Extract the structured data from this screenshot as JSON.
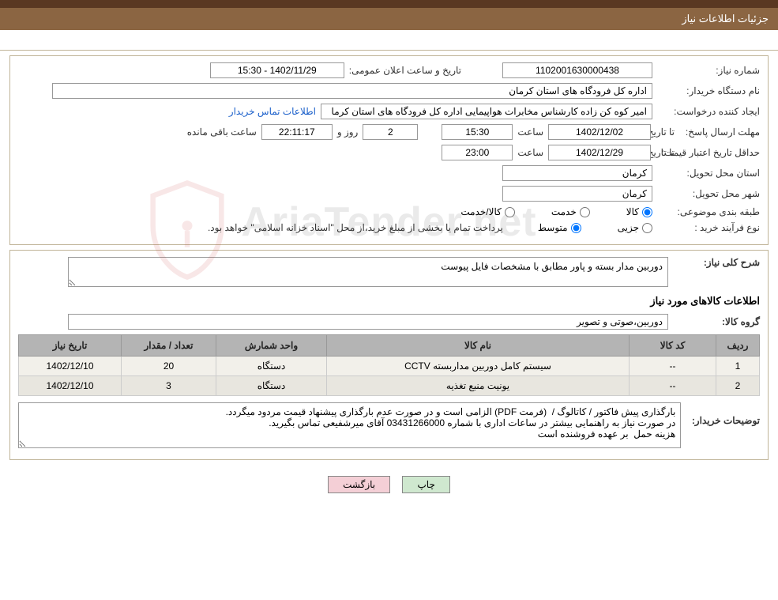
{
  "header": {
    "title": "جزئیات اطلاعات نیاز"
  },
  "fields": {
    "need_number_label": "شماره نیاز:",
    "need_number": "1102001630000438",
    "announce_label": "تاریخ و ساعت اعلان عمومی:",
    "announce_value": "1402/11/29 - 15:30",
    "buyer_org_label": "نام دستگاه خریدار:",
    "buyer_org": "اداره کل فرودگاه های استان کرمان",
    "requester_label": "ایجاد کننده درخواست:",
    "requester": "امیر کوه کن زاده کارشناس مخابرات هواپیمایی اداره کل فرودگاه های استان کرما",
    "buyer_contact_link": "اطلاعات تماس خریدار",
    "deadline_label_1": "مهلت ارسال پاسخ:",
    "deadline_prefix": "تا تاریخ:",
    "deadline_date": "1402/12/02",
    "time_label": "ساعت",
    "deadline_time": "15:30",
    "days_value": "2",
    "days_and": "روز و",
    "countdown": "22:11:17",
    "remaining_label": "ساعت باقی مانده",
    "validity_label": "حداقل تاریخ اعتبار قیمت:",
    "validity_prefix": "تا تاریخ:",
    "validity_date": "1402/12/29",
    "validity_time": "23:00",
    "province_label": "استان محل تحویل:",
    "province": "کرمان",
    "city_label": "شهر محل تحویل:",
    "city": "کرمان",
    "category_label": "طبقه بندی موضوعی:",
    "cat_goods": "کالا",
    "cat_service": "خدمت",
    "cat_goods_service": "کالا/خدمت",
    "purchase_type_label": "نوع فرآیند خرید :",
    "pt_small": "جزیی",
    "pt_medium": "متوسط",
    "treasury_note": "پرداخت تمام یا بخشی از مبلغ خرید،از محل \"اسناد خزانه اسلامی\" خواهد بود."
  },
  "section2": {
    "overview_label": "شرح کلی نیاز:",
    "overview_text": "دوربین مدار بسته و پاور مطابق با مشخصات فایل پیوست",
    "items_header": "اطلاعات کالاهای مورد نیاز",
    "group_label": "گروه کالا:",
    "group_value": "دوربین،صوتی و تصویر"
  },
  "table": {
    "headers": {
      "row": "ردیف",
      "code": "کد کالا",
      "name": "نام کالا",
      "unit": "واحد شمارش",
      "qty": "تعداد / مقدار",
      "date": "تاریخ نیاز"
    },
    "rows": [
      {
        "idx": "1",
        "code": "--",
        "name": "سیستم کامل دوربین مداربسته CCTV",
        "unit": "دستگاه",
        "qty": "20",
        "date": "1402/12/10"
      },
      {
        "idx": "2",
        "code": "--",
        "name": "یونیت منبع تغذیه",
        "unit": "دستگاه",
        "qty": "3",
        "date": "1402/12/10"
      }
    ]
  },
  "buyer_notes": {
    "label": "توضیحات خریدار:",
    "text": "بارگذاری پیش فاکتور / کاتالوگ /  (فرمت PDF) الزامی است و در صورت عدم بارگذاری پیشنهاد قیمت مردود میگردد.\nدر صورت نیاز به راهنمایی بیشتر در ساعات اداری با شماره 03431266000 آقای میرشفیعی تماس بگیرید.\nهزینه حمل  بر عهده فروشنده است"
  },
  "buttons": {
    "print": "چاپ",
    "back": "بازگشت"
  },
  "watermark": "AriaTender.net"
}
